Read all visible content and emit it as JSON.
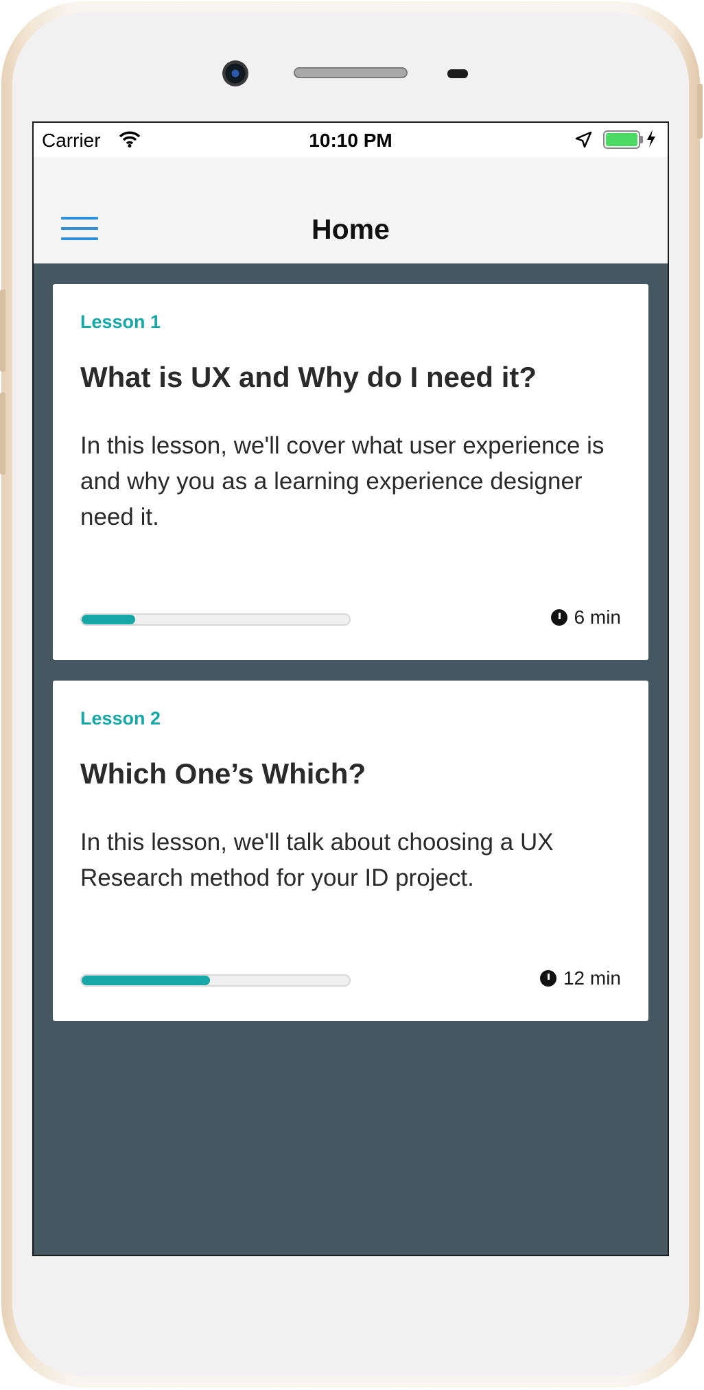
{
  "status_bar": {
    "carrier": "Carrier",
    "time": "10:10 PM"
  },
  "nav": {
    "title": "Home",
    "menu_icon": "hamburger-menu-icon"
  },
  "lessons": [
    {
      "label": "Lesson 1",
      "title": "What is UX and Why do I need it?",
      "description": "In this lesson, we'll cover what user experience is and why you as a learning experience designer need it.",
      "progress_percent": 20,
      "duration": "6 min"
    },
    {
      "label": "Lesson 2",
      "title": "Which One’s Which?",
      "description": "In this lesson, we'll talk about choosing a UX Research method for your ID project.",
      "progress_percent": 48,
      "duration": "12 min"
    }
  ],
  "colors": {
    "accent": "#17a7a7",
    "background": "#455760",
    "menu_icon": "#2f8fd8",
    "battery": "#4cd964"
  }
}
